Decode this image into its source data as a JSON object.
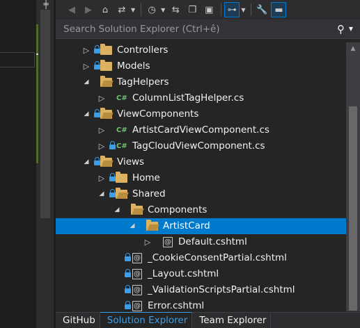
{
  "window": {
    "panel_title": "Solution Explorer"
  },
  "toolbar": {
    "icons": [
      "back-icon",
      "forward-icon",
      "home-icon",
      "switch-views-icon",
      "pending-changes-icon",
      "sync-icon",
      "collapse-all-icon",
      "show-all-files-icon",
      "preview-selected-icon",
      "properties-icon",
      "pin-icon"
    ]
  },
  "search": {
    "placeholder": "Search Solution Explorer (Ctrl+ê)"
  },
  "tree": {
    "items": [
      {
        "label": "Controllers",
        "level": 0,
        "state": "collapsed",
        "icon": "folder",
        "locked": true
      },
      {
        "label": "Models",
        "level": 0,
        "state": "collapsed",
        "icon": "folder",
        "locked": true
      },
      {
        "label": "TagHelpers",
        "level": 0,
        "state": "expanded",
        "icon": "folder",
        "locked": false
      },
      {
        "label": "ColumnListTagHelper.cs",
        "level": 1,
        "state": "collapsed",
        "icon": "csharp",
        "locked": false
      },
      {
        "label": "ViewComponents",
        "level": 0,
        "state": "expanded",
        "icon": "folder",
        "locked": true
      },
      {
        "label": "ArtistCardViewComponent.cs",
        "level": 1,
        "state": "collapsed",
        "icon": "csharp",
        "locked": false
      },
      {
        "label": "TagCloudViewComponent.cs",
        "level": 1,
        "state": "collapsed",
        "icon": "csharp",
        "locked": true
      },
      {
        "label": "Views",
        "level": 0,
        "state": "expanded",
        "icon": "folder",
        "locked": true
      },
      {
        "label": "Home",
        "level": 1,
        "state": "collapsed",
        "icon": "folder",
        "locked": true
      },
      {
        "label": "Shared",
        "level": 1,
        "state": "expanded",
        "icon": "folder",
        "locked": true
      },
      {
        "label": "Components",
        "level": 2,
        "state": "expanded",
        "icon": "folder",
        "locked": false
      },
      {
        "label": "ArtistCard",
        "level": 3,
        "state": "expanded",
        "icon": "folder",
        "locked": false,
        "selected": true
      },
      {
        "label": "Default.cshtml",
        "level": 4,
        "state": "collapsed",
        "icon": "cshtml",
        "locked": false
      },
      {
        "label": "_CookieConsentPartial.cshtml",
        "level": 2,
        "state": "none",
        "icon": "cshtml",
        "locked": true
      },
      {
        "label": "_Layout.cshtml",
        "level": 2,
        "state": "none",
        "icon": "cshtml",
        "locked": true
      },
      {
        "label": "_ValidationScriptsPartial.cshtml",
        "level": 2,
        "state": "none",
        "icon": "cshtml",
        "locked": true
      },
      {
        "label": "Error.cshtml",
        "level": 2,
        "state": "none",
        "icon": "cshtml",
        "locked": true
      }
    ]
  },
  "tabs": [
    {
      "label": "GitHub",
      "active": false
    },
    {
      "label": "Solution Explorer",
      "active": true
    },
    {
      "label": "Team Explorer",
      "active": false
    }
  ],
  "colors": {
    "selection": "#007acc",
    "folder": "#dcb262",
    "lock": "#3c9ee8",
    "csharp": "#6ec36e",
    "active_tab_text": "#3c9ee8"
  }
}
